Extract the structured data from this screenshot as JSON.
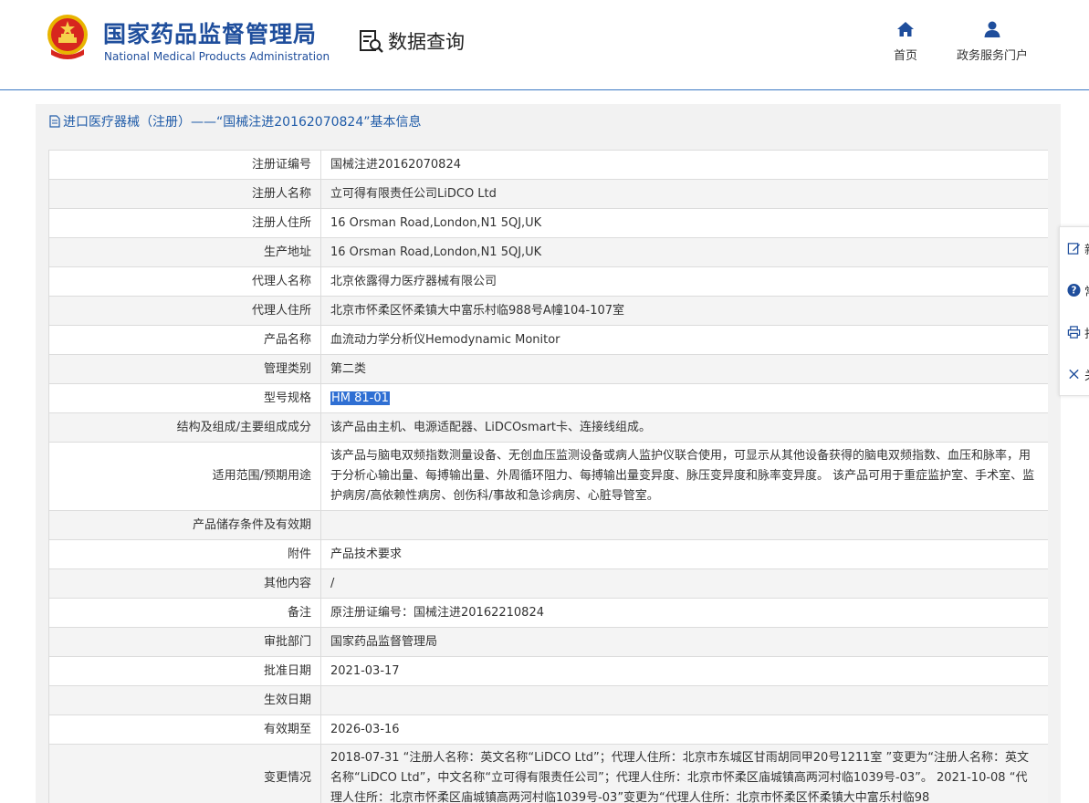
{
  "header": {
    "brand_cn": "国家药品监督管理局",
    "brand_en": "National Medical Products Administration",
    "section_title": "数据查询",
    "nav": [
      {
        "label": "首页"
      },
      {
        "label": "政务服务门户"
      }
    ]
  },
  "breadcrumb": "进口医疗器械（注册）——“国械注进20162070824”基本信息",
  "rows": [
    {
      "label": "注册证编号",
      "value": "国械注进20162070824"
    },
    {
      "label": "注册人名称",
      "value": "立可得有限责任公司LiDCO Ltd"
    },
    {
      "label": "注册人住所",
      "value": "16 Orsman Road,London,N1 5QJ,UK"
    },
    {
      "label": "生产地址",
      "value": "16 Orsman Road,London,N1 5QJ,UK"
    },
    {
      "label": "代理人名称",
      "value": "北京依露得力医疗器械有限公司"
    },
    {
      "label": "代理人住所",
      "value": "北京市怀柔区怀柔镇大中富乐村临988号A幢104-107室"
    },
    {
      "label": "产品名称",
      "value": "血流动力学分析仪Hemodynamic Monitor"
    },
    {
      "label": "管理类别",
      "value": "第二类"
    },
    {
      "label": "型号规格",
      "value": "HM 81-01"
    },
    {
      "label": "结构及组成/主要组成成分",
      "value": "该产品由主机、电源适配器、LiDCOsmart卡、连接线组成。"
    },
    {
      "label": "适用范围/预期用途",
      "value": "该产品与脑电双频指数测量设备、无创血压监测设备或病人监护仪联合使用，可显示从其他设备获得的脑电双频指数、血压和脉率，用于分析心输出量、每搏输出量、外周循环阻力、每搏输出量变异度、脉压变异度和脉率变异度。 该产品可用于重症监护室、手术室、监护病房/高依赖性病房、创伤科/事故和急诊病房、心脏导管室。"
    },
    {
      "label": "产品储存条件及有效期",
      "value": ""
    },
    {
      "label": "附件",
      "value": "产品技术要求"
    },
    {
      "label": "其他内容",
      "value": "/"
    },
    {
      "label": "备注",
      "value": "原注册证编号：国械注进20162210824"
    },
    {
      "label": "审批部门",
      "value": "国家药品监督管理局"
    },
    {
      "label": "批准日期",
      "value": "2021-03-17"
    },
    {
      "label": "生效日期",
      "value": ""
    },
    {
      "label": "有效期至",
      "value": "2026-03-16"
    },
    {
      "label": "变更情况",
      "value": "2018-07-31 “注册人名称：英文名称“LiDCO Ltd”；代理人住所：北京市东城区甘雨胡同甲20号1211室 ”变更为“注册人名称：英文名称“LiDCO Ltd”，中文名称“立可得有限责任公司”；代理人住所：北京市怀柔区庙城镇高两河村临1039号-03”。 2021-10-08 “代理人住所：北京市怀柔区庙城镇高两河村临1039号-03”变更为“代理人住所：北京市怀柔区怀柔镇大中富乐村临98"
    }
  ],
  "sidebar": {
    "items": [
      {
        "label": "新"
      },
      {
        "label": "常"
      },
      {
        "label": "打"
      },
      {
        "label": "关"
      }
    ]
  },
  "colors": {
    "brand_blue": "#1f4e9c",
    "link_blue": "#1f5ba8",
    "selection": "#2f6fd3"
  }
}
